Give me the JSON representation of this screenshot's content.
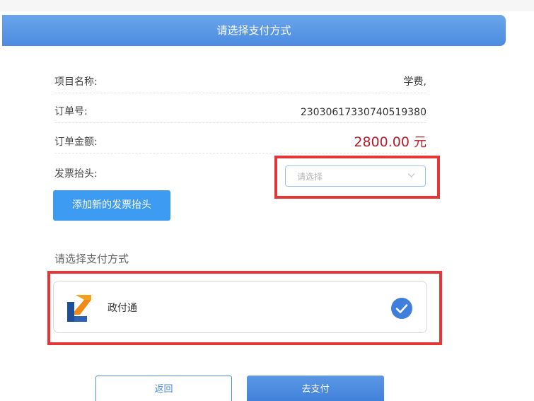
{
  "header": {
    "title": "请选择支付方式"
  },
  "order": {
    "project_label": "项目名称:",
    "project_value": "学费,",
    "order_no_label": "订单号:",
    "order_no_value": "23030617330740519380",
    "amount_label": "订单金额:",
    "amount_value": "2800.00",
    "amount_unit": "元",
    "invoice_label": "发票抬头:",
    "invoice_placeholder": "请选择"
  },
  "actions": {
    "add_invoice_label": "添加新的发票抬头",
    "back_label": "返回",
    "pay_label": "去支付"
  },
  "payment": {
    "section_title": "请选择支付方式",
    "methods": [
      {
        "name": "政付通",
        "icon": "zhengfutong-logo-icon",
        "selected": true
      }
    ]
  },
  "colors": {
    "accent": "#4c8be0",
    "amount": "#b81c2a",
    "highlight_box": "#e53535",
    "add_button": "#3d9bf2"
  }
}
